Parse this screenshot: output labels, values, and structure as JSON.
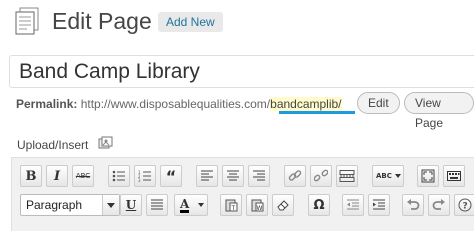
{
  "header": {
    "title": "Edit Page",
    "add_new_label": "Add New",
    "icon": "pages-icon"
  },
  "post_title": {
    "value": "Band Camp Library"
  },
  "permalink": {
    "label": "Permalink:",
    "base_url": "http://www.disposablequalities.com/",
    "slug": "bandcamplib/",
    "edit_label": "Edit",
    "view_label": "View Page"
  },
  "upload": {
    "label": "Upload/Insert",
    "icon": "add-media-icon"
  },
  "toolbar": {
    "row1": [
      "bold",
      "italic",
      "strikethrough",
      "bulleted-list",
      "numbered-list",
      "blockquote",
      "align-left",
      "align-center",
      "align-right",
      "insert-link",
      "unlink",
      "insert-more",
      "spellcheck",
      "fullscreen",
      "kitchen-sink"
    ],
    "row2": [
      "format-select",
      "underline",
      "justify",
      "text-color",
      "paste-as-text",
      "paste-from-word",
      "clear-formatting",
      "special-character",
      "outdent",
      "indent",
      "undo",
      "redo",
      "help"
    ],
    "bold_glyph": "B",
    "italic_glyph": "I",
    "strike_glyph": "ABC",
    "quote_glyph": "“",
    "spell_glyph": "ABC",
    "underline_glyph": "U",
    "textcolor_glyph": "A",
    "omega_glyph": "Ω",
    "format_value": "Paragraph"
  }
}
